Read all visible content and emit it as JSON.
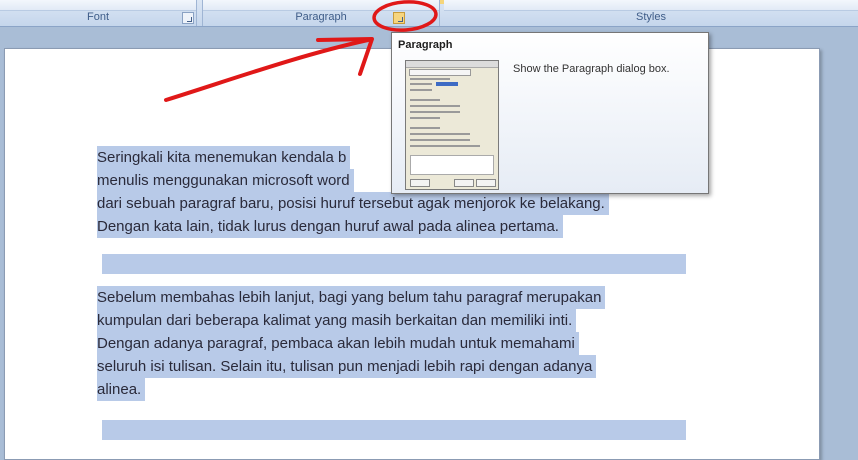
{
  "ribbon": {
    "groups": [
      {
        "name": "font",
        "label": "Font"
      },
      {
        "name": "paragraph",
        "label": "Paragraph"
      },
      {
        "name": "styles",
        "label": "Styles"
      }
    ]
  },
  "tooltip": {
    "title": "Paragraph",
    "description": "Show the Paragraph dialog box."
  },
  "document": {
    "paragraph1": [
      "Seringkali kita menemukan kendala b",
      "menulis menggunakan microsoft word",
      "dari sebuah paragraf baru, posisi huruf tersebut agak menjorok ke belakang.",
      "Dengan kata lain, tidak lurus dengan huruf awal pada alinea pertama."
    ],
    "paragraph2": [
      "Sebelum membahas lebih lanjut, bagi yang belum tahu paragraf merupakan",
      "kumpulan dari beberapa kalimat yang masih berkaitan dan memiliki inti.",
      "Dengan adanya paragraf, pembaca akan lebih mudah untuk memahami",
      "seluruh isi tulisan. Selain itu, tulisan pun menjadi lebih rapi dengan adanya",
      "alinea."
    ]
  },
  "annotation": {
    "color": "#e01818"
  }
}
